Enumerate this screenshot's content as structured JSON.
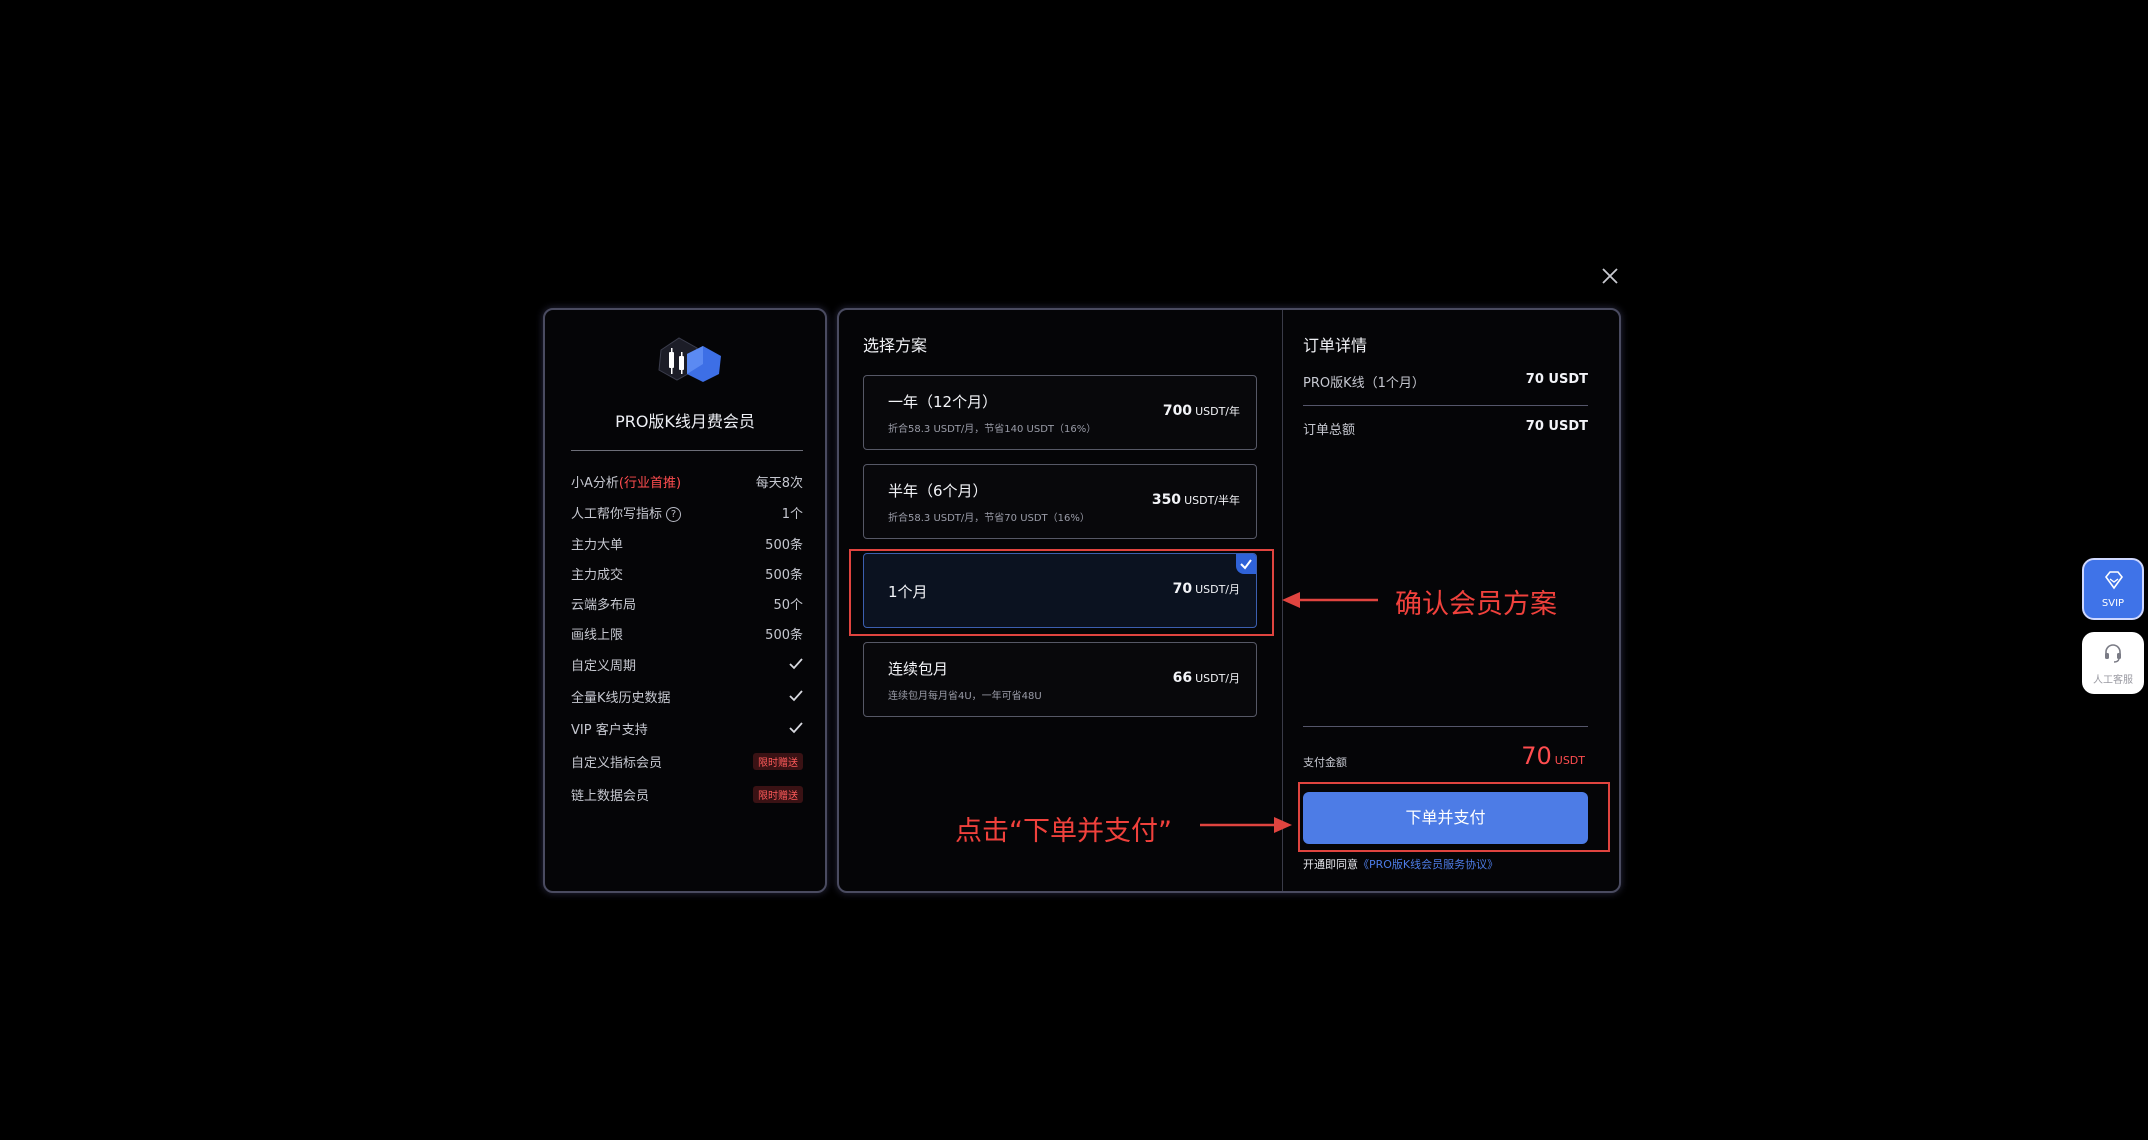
{
  "left_panel": {
    "plan_name": "PRO版K线月费会员",
    "features": [
      {
        "label": "小A分析",
        "highlight": "(行业首推)",
        "value": "每天8次",
        "kind": "text"
      },
      {
        "label": "人工帮你写指标",
        "value": "1个",
        "kind": "text",
        "help": "?"
      },
      {
        "label": "主力大单",
        "value": "500条",
        "kind": "text"
      },
      {
        "label": "主力成交",
        "value": "500条",
        "kind": "text"
      },
      {
        "label": "云端多布局",
        "value": "50个",
        "kind": "text"
      },
      {
        "label": "画线上限",
        "value": "500条",
        "kind": "text"
      },
      {
        "label": "自定义周期",
        "kind": "check"
      },
      {
        "label": "全量K线历史数据",
        "kind": "check"
      },
      {
        "label": "VIP 客户支持",
        "kind": "check"
      },
      {
        "label": "自定义指标会员",
        "value": "限时赠送",
        "kind": "badge"
      },
      {
        "label": "链上数据会员",
        "value": "限时赠送",
        "kind": "badge"
      }
    ]
  },
  "plans": {
    "title": "选择方案",
    "items": [
      {
        "title": "一年（12个月）",
        "sub": "折合58.3 USDT/月，节省140 USDT（16%）",
        "price": "700",
        "unit": "USDT/年",
        "selected": false
      },
      {
        "title": "半年（6个月）",
        "sub": "折合58.3 USDT/月，节省70 USDT（16%）",
        "price": "350",
        "unit": "USDT/半年",
        "selected": false
      },
      {
        "title": "1个月",
        "sub": "",
        "price": "70",
        "unit": "USDT/月",
        "selected": true
      },
      {
        "title": "连续包月",
        "sub": "连续包月每月省4U，一年可省48U",
        "price": "66",
        "unit": "USDT/月",
        "selected": false
      }
    ]
  },
  "order": {
    "title": "订单详情",
    "item_label": "PRO版K线（1个月）",
    "item_amount": "70 USDT",
    "total_label": "订单总额",
    "total_amount": "70 USDT",
    "pay_label": "支付金额",
    "pay_amount": "70",
    "pay_unit": "USDT",
    "pay_button": "下单并支付",
    "agree_prefix": "开通即同意",
    "agree_link": "《PRO版K线会员服务协议》"
  },
  "annotations": {
    "confirm_plan": "确认会员方案",
    "click_pay": "点击“下单并支付”"
  },
  "widgets": {
    "svip_label": "SVIP",
    "service_label": "人工客服"
  },
  "colors": {
    "accent": "#4d7ce6",
    "annotation": "#e0443f",
    "price_red": "#ff4d4f"
  }
}
